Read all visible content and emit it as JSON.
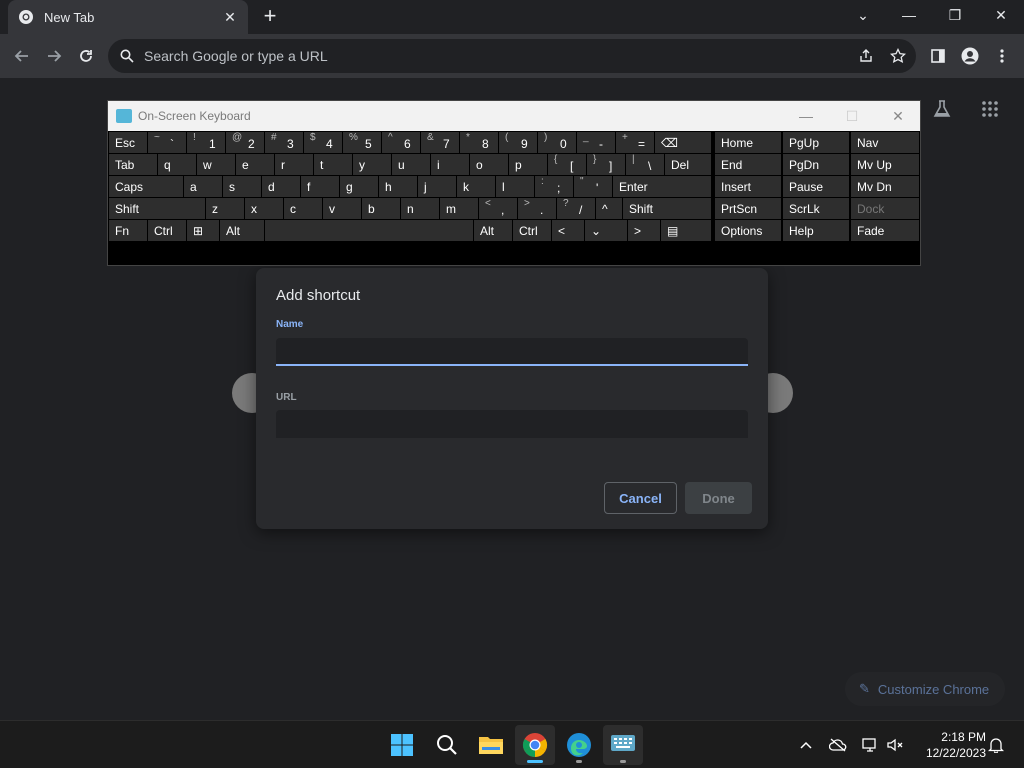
{
  "browser": {
    "tab": {
      "title": "New Tab",
      "close_glyph": "✕"
    },
    "new_tab_glyph": "+",
    "window_controls": {
      "chevron": "⌄",
      "minimize": "—",
      "restore": "❐",
      "close": "✕"
    },
    "omnibox": {
      "placeholder": "Search Google or type a URL"
    }
  },
  "ntp": {
    "customize_label": "Customize Chrome"
  },
  "osk": {
    "title": "On-Screen Keyboard",
    "rows": [
      [
        {
          "label": "Esc"
        },
        {
          "sup": "~",
          "main": "`"
        },
        {
          "sup": "!",
          "main": "1"
        },
        {
          "sup": "@",
          "main": "2"
        },
        {
          "sup": "#",
          "main": "3"
        },
        {
          "sup": "$",
          "main": "4"
        },
        {
          "sup": "%",
          "main": "5"
        },
        {
          "sup": "^",
          "main": "6"
        },
        {
          "sup": "&",
          "main": "7"
        },
        {
          "sup": "*",
          "main": "8"
        },
        {
          "sup": "(",
          "main": "9"
        },
        {
          "sup": ")",
          "main": "0"
        },
        {
          "sup": "_",
          "main": "-"
        },
        {
          "sup": "+",
          "main": "="
        },
        {
          "label": "⌫"
        }
      ],
      [
        {
          "label": "Tab"
        },
        {
          "label": "q"
        },
        {
          "label": "w"
        },
        {
          "label": "e"
        },
        {
          "label": "r"
        },
        {
          "label": "t"
        },
        {
          "label": "y"
        },
        {
          "label": "u"
        },
        {
          "label": "i"
        },
        {
          "label": "o"
        },
        {
          "label": "p"
        },
        {
          "sup": "{",
          "main": "["
        },
        {
          "sup": "}",
          "main": "]"
        },
        {
          "sup": "|",
          "main": "\\"
        },
        {
          "label": "Del"
        }
      ],
      [
        {
          "label": "Caps"
        },
        {
          "label": "a"
        },
        {
          "label": "s"
        },
        {
          "label": "d"
        },
        {
          "label": "f"
        },
        {
          "label": "g"
        },
        {
          "label": "h"
        },
        {
          "label": "j"
        },
        {
          "label": "k"
        },
        {
          "label": "l"
        },
        {
          "sup": ":",
          "main": ";"
        },
        {
          "sup": "\"",
          "main": "'"
        },
        {
          "label": "Enter"
        }
      ],
      [
        {
          "label": "Shift"
        },
        {
          "label": "z"
        },
        {
          "label": "x"
        },
        {
          "label": "c"
        },
        {
          "label": "v"
        },
        {
          "label": "b"
        },
        {
          "label": "n"
        },
        {
          "label": "m"
        },
        {
          "sup": "<",
          "main": ","
        },
        {
          "sup": ">",
          "main": "."
        },
        {
          "sup": "?",
          "main": "/"
        },
        {
          "label": "^"
        },
        {
          "label": "Shift"
        }
      ],
      [
        {
          "label": "Fn"
        },
        {
          "label": "Ctrl"
        },
        {
          "label": "⊞"
        },
        {
          "label": "Alt"
        },
        {
          "label": ""
        },
        {
          "label": "Alt"
        },
        {
          "label": "Ctrl"
        },
        {
          "label": "<"
        },
        {
          "label": "⌄"
        },
        {
          "label": ">"
        },
        {
          "label": "▤"
        }
      ]
    ],
    "nav_keys": [
      [
        "Home",
        "PgUp",
        "Nav"
      ],
      [
        "End",
        "PgDn",
        "Mv Up"
      ],
      [
        "Insert",
        "Pause",
        "Mv Dn"
      ],
      [
        "PrtScn",
        "ScrLk",
        "Dock"
      ],
      [
        "Options",
        "Help",
        "Fade"
      ]
    ]
  },
  "dialog": {
    "title": "Add shortcut",
    "name_label": "Name",
    "name_value": "",
    "url_label": "URL",
    "url_value": "",
    "cancel_label": "Cancel",
    "done_label": "Done",
    "accent": "#8ab4f8"
  },
  "taskbar": {
    "time": "2:18 PM",
    "date": "12/22/2023"
  }
}
